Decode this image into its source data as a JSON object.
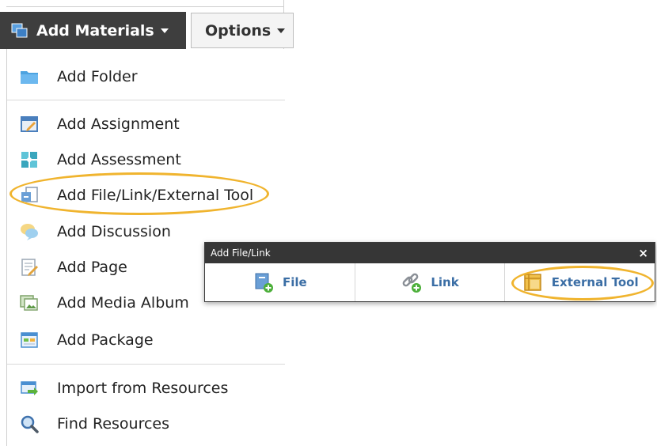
{
  "toolbar": {
    "add_materials_label": "Add Materials",
    "options_label": "Options"
  },
  "menu": {
    "items": [
      {
        "label": "Add Folder",
        "icon": "folder-icon"
      },
      {
        "label": "Add Assignment",
        "icon": "assignment-icon"
      },
      {
        "label": "Add Assessment",
        "icon": "assessment-icon"
      },
      {
        "label": "Add File/Link/External Tool",
        "icon": "file-link-icon"
      },
      {
        "label": "Add Discussion",
        "icon": "discussion-icon"
      },
      {
        "label": "Add Page",
        "icon": "page-icon"
      },
      {
        "label": "Add Media Album",
        "icon": "media-album-icon"
      },
      {
        "label": "Add Package",
        "icon": "package-icon"
      },
      {
        "label": "Import from Resources",
        "icon": "import-icon"
      },
      {
        "label": "Find Resources",
        "icon": "search-icon"
      }
    ]
  },
  "dialog": {
    "title": "Add File/Link",
    "close_label": "×",
    "options": [
      {
        "label": "File",
        "icon": "file-add-icon"
      },
      {
        "label": "Link",
        "icon": "link-add-icon"
      },
      {
        "label": "External Tool",
        "icon": "external-tool-icon"
      }
    ]
  },
  "colors": {
    "highlight": "#f0b42e",
    "link_blue": "#3b6ea5",
    "toolbar_dark": "#3e3e3e"
  }
}
